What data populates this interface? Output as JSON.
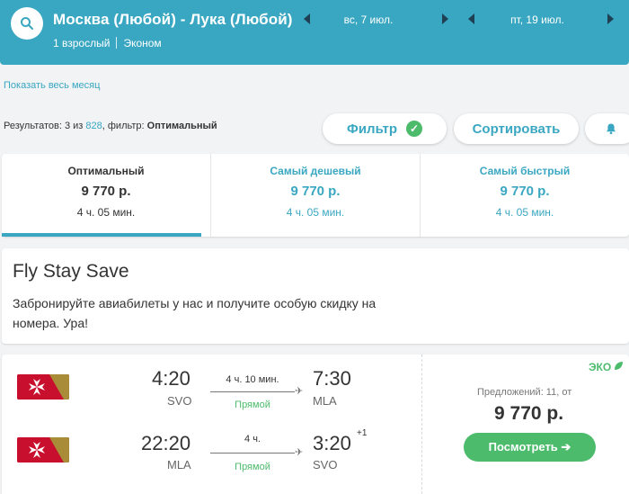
{
  "header": {
    "route": "Москва (Любой) - Лука (Любой)",
    "passengers": "1 взрослый",
    "cabin": "Эконом",
    "depart_date": "вс, 7 июл.",
    "return_date": "пт, 19 июл.",
    "icons": [
      "search-icon",
      "prev-arrow-icon",
      "next-arrow-icon"
    ]
  },
  "show_month_link": "Показать весь месяц",
  "results": {
    "prefix": "Результатов: 3 из ",
    "total": "828",
    "filter_prefix": ", фильтр: ",
    "filter_value": "Оптимальный"
  },
  "toolbar": {
    "filter_label": "Фильтр",
    "sort_label": "Сортировать",
    "check_icon": "✓"
  },
  "tabs": [
    {
      "label": "Оптимальный",
      "price": "9 770 р.",
      "duration": "4 ч. 05 мин.",
      "active": true
    },
    {
      "label": "Самый дешевый",
      "price": "9 770 р.",
      "duration": "4 ч. 05 мин.",
      "active": false
    },
    {
      "label": "Самый быстрый",
      "price": "9 770 р.",
      "duration": "4 ч. 05 мин.",
      "active": false
    }
  ],
  "promo": {
    "title": "Fly Stay Save",
    "text": "Забронируйте авиабилеты у нас и получите особую скидку на номера. Ура!"
  },
  "ticket": {
    "outbound": {
      "dep_time": "4:20",
      "dep_code": "SVO",
      "duration": "4 ч. 10 мин.",
      "type": "Прямой",
      "arr_time": "7:30",
      "arr_code": "MLA",
      "day_shift": ""
    },
    "inbound": {
      "dep_time": "22:20",
      "dep_code": "MLA",
      "duration": "4 ч.",
      "type": "Прямой",
      "arr_time": "3:20",
      "arr_code": "SVO",
      "day_shift": "+1"
    },
    "eco_label": "ЭКО",
    "offers": "Предложений: 11, от",
    "price": "9 770 р.",
    "view_button": "Посмотреть ➔",
    "airline_logo": "maltese-cross-logo"
  },
  "colors": {
    "accent": "#3aa7c2",
    "green": "#4cbb6c",
    "logo_red": "#c8102e"
  }
}
